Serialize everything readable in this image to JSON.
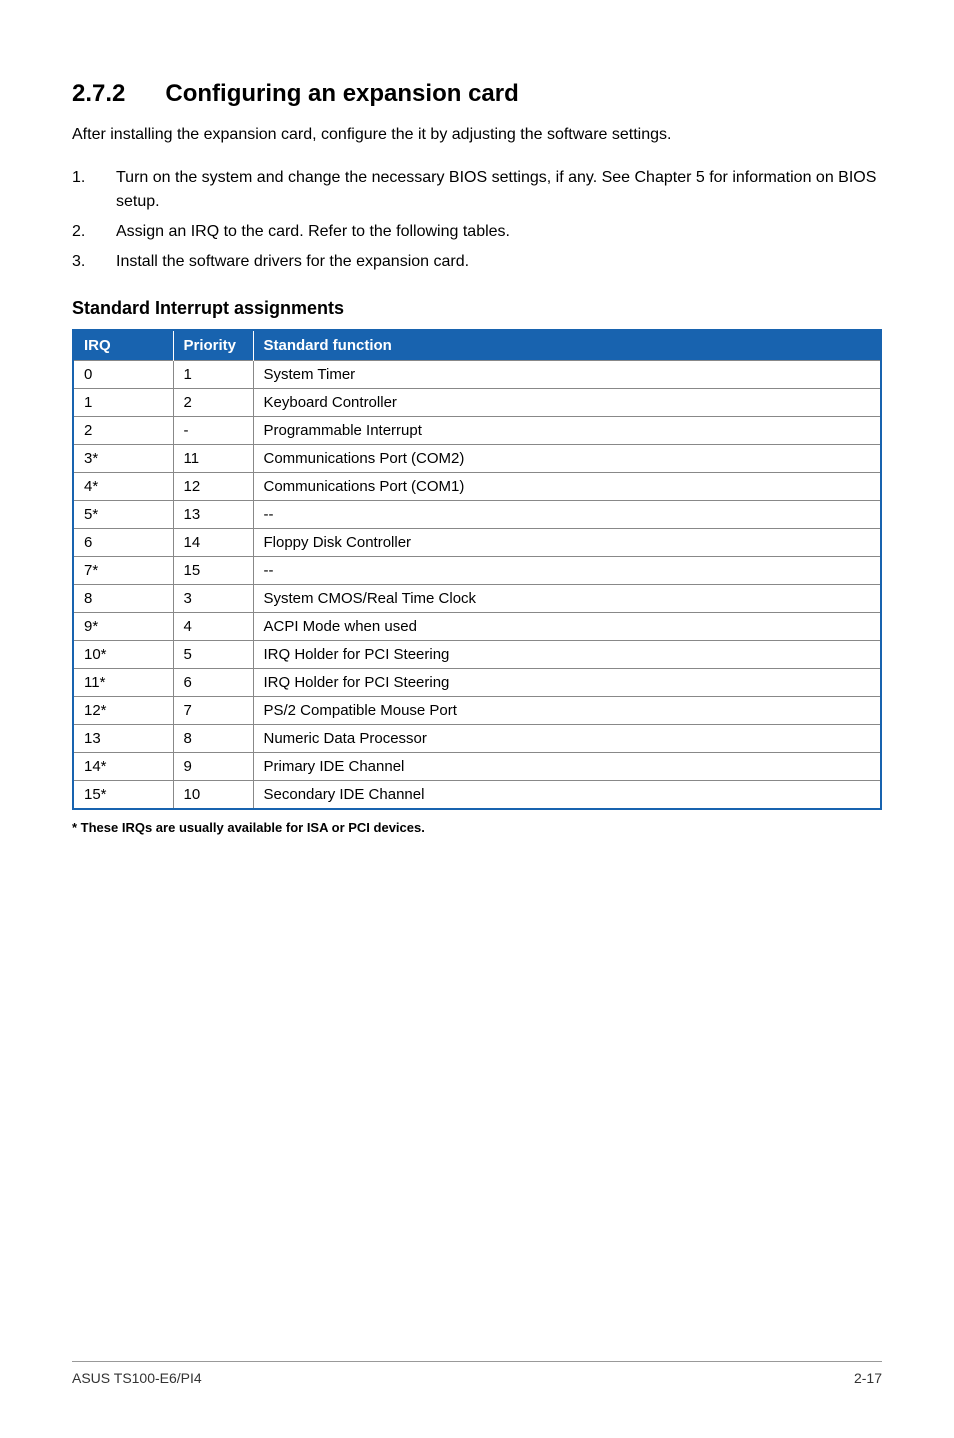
{
  "section": {
    "number": "2.7.2",
    "title": "Configuring an expansion card"
  },
  "intro": "After installing the expansion card, configure the it by adjusting the software settings.",
  "steps": [
    {
      "num": "1.",
      "text": "Turn on the system and change the necessary BIOS settings, if any. See Chapter 5 for information on BIOS setup."
    },
    {
      "num": "2.",
      "text": "Assign an IRQ to the card. Refer to the following tables."
    },
    {
      "num": "3.",
      "text": "Install the software drivers for the expansion card."
    }
  ],
  "sub_heading": "Standard Interrupt assignments",
  "table": {
    "headers": {
      "irq": "IRQ",
      "priority": "Priority",
      "function": "Standard function"
    },
    "rows": [
      {
        "irq": "0",
        "priority": "1",
        "function": "System Timer"
      },
      {
        "irq": "1",
        "priority": "2",
        "function": "Keyboard Controller"
      },
      {
        "irq": "2",
        "priority": "-",
        "function": "Programmable Interrupt"
      },
      {
        "irq": "3*",
        "priority": "11",
        "function": "Communications Port (COM2)"
      },
      {
        "irq": "4*",
        "priority": "12",
        "function": "Communications Port (COM1)"
      },
      {
        "irq": "5*",
        "priority": "13",
        "function": "--"
      },
      {
        "irq": "6",
        "priority": "14",
        "function": "Floppy Disk Controller"
      },
      {
        "irq": "7*",
        "priority": "15",
        "function": "--"
      },
      {
        "irq": "8",
        "priority": "3",
        "function": "System CMOS/Real Time Clock"
      },
      {
        "irq": "9*",
        "priority": "4",
        "function": "ACPI Mode when used"
      },
      {
        "irq": "10*",
        "priority": "5",
        "function": "IRQ Holder for PCI Steering"
      },
      {
        "irq": "11*",
        "priority": "6",
        "function": "IRQ Holder for PCI Steering"
      },
      {
        "irq": "12*",
        "priority": "7",
        "function": "PS/2 Compatible Mouse Port"
      },
      {
        "irq": "13",
        "priority": "8",
        "function": "Numeric Data Processor"
      },
      {
        "irq": "14*",
        "priority": "9",
        "function": "Primary IDE Channel"
      },
      {
        "irq": "15*",
        "priority": "10",
        "function": "Secondary IDE Channel"
      }
    ]
  },
  "footnote": "* These IRQs are usually available for ISA or PCI devices.",
  "footer": {
    "left": "ASUS TS100-E6/PI4",
    "right": "2-17"
  }
}
